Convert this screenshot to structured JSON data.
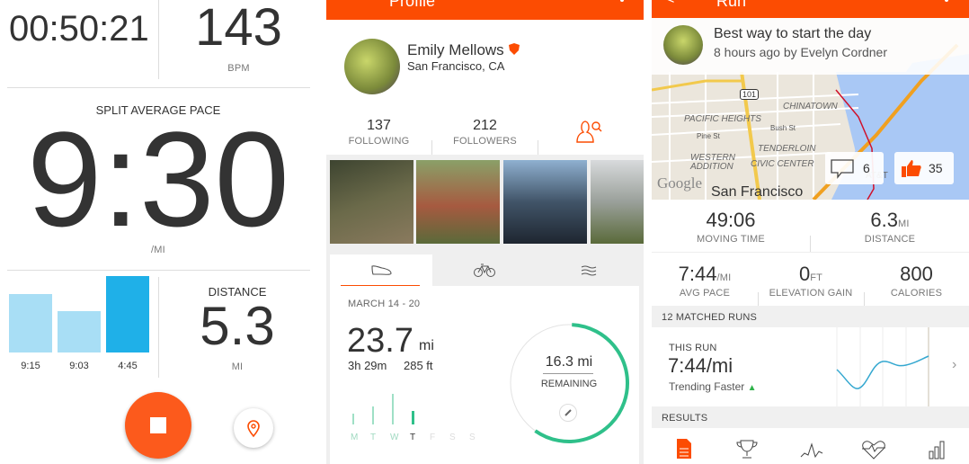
{
  "recording": {
    "elapsed": "00:50:21",
    "heart_rate": "143",
    "heart_rate_unit": "BPM",
    "split_label": "SPLIT AVERAGE PACE",
    "split_pace": "9:30",
    "pace_unit": "/MI",
    "splits": [
      {
        "label": "9:15",
        "relative": 0.76,
        "current": false
      },
      {
        "label": "9:03",
        "relative": 0.54,
        "current": false
      },
      {
        "label": "4:45",
        "relative": 1.0,
        "current": true
      }
    ],
    "distance_label": "DISTANCE",
    "distance": "5.3",
    "distance_unit": "MI",
    "stop_icon": "stop-icon",
    "location_icon": "location-pin-icon"
  },
  "profile": {
    "title": "Profile",
    "name": "Emily Mellows",
    "location": "San Francisco, CA",
    "following": "137",
    "following_label": "FOLLOWING",
    "followers": "212",
    "followers_label": "FOLLOWERS",
    "tabs": [
      {
        "icon": "shoe-icon",
        "active": true
      },
      {
        "icon": "bike-icon",
        "active": false
      },
      {
        "icon": "swim-icon",
        "active": false
      }
    ],
    "week": "MARCH 14 - 20",
    "total": "23.7",
    "total_unit": "mi",
    "time": "3h 29m",
    "elevation": "285 ft",
    "days": [
      {
        "label": "M",
        "value": 0.35
      },
      {
        "label": "T",
        "value": 0.6
      },
      {
        "label": "W",
        "value": 1.0
      },
      {
        "label": "T",
        "value": 0.45
      },
      {
        "label": "F",
        "value": 0
      },
      {
        "label": "S",
        "value": 0
      },
      {
        "label": "S",
        "value": 0
      }
    ],
    "remaining": "16.3 mi",
    "remaining_label": "REMAINING",
    "goal_progress": 0.59,
    "accent": "#fc4c02",
    "green": "#2fc08a"
  },
  "activity": {
    "title": "Run",
    "post_title": "Best way to start the day",
    "post_meta": "8 hours ago by Evelyn Cordner",
    "map_labels": {
      "highway": "101",
      "pacific": "PACIFIC HEIGHTS",
      "chinatown": "CHINATOWN",
      "pine": "Pine St",
      "bush": "Bush St",
      "tenderloin": "TENDERLOIN",
      "western": "WESTERN",
      "addition": "ADDITION",
      "civic": "CIVIC CENTER",
      "google": "Google",
      "city": "San Francisco",
      "att": "AT&T"
    },
    "comments": "6",
    "kudos": "35",
    "moving_time": "49:06",
    "moving_time_label": "MOVING TIME",
    "distance": "6.3",
    "distance_unit": "MI",
    "distance_label": "DISTANCE",
    "pace": "7:44",
    "pace_unit": "/MI",
    "pace_label": "AVG PACE",
    "elev": "0",
    "elev_unit": "FT",
    "elev_label": "ELEVATION GAIN",
    "calories": "800",
    "calories_label": "CALORIES",
    "matched_header": "12 MATCHED RUNS",
    "this_run": "THIS RUN",
    "this_pace": "7:44/mi",
    "trend": "Trending Faster",
    "results_header": "RESULTS",
    "bottom_icons": [
      "results-icon",
      "trophy-icon",
      "segments-icon",
      "heart-rate-icon",
      "analysis-icon"
    ]
  }
}
